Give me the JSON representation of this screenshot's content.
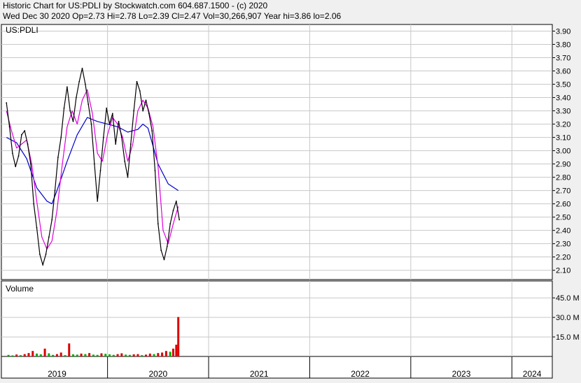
{
  "header": {
    "line1": "Historic Chart for US:PDLI by Stockwatch.com 604.687.1500 - (c) 2020",
    "line2": "Wed Dec 30 2020   Op=2.73  Hi=2.78  Lo=2.39  Cl=2.47  Vol=30,266,907  Year hi=3.86  lo=2.06"
  },
  "chart_data": {
    "type": "line",
    "symbol_label": "US:PDLI",
    "volume_label": "Volume",
    "price_axis": {
      "ticks": [
        "3.90",
        "3.80",
        "3.70",
        "3.60",
        "3.50",
        "3.40",
        "3.30",
        "3.20",
        "3.10",
        "3.00",
        "2.90",
        "2.80",
        "2.70",
        "2.60",
        "2.50",
        "2.40",
        "2.30",
        "2.20",
        "2.10"
      ],
      "range": [
        2.03,
        3.95
      ]
    },
    "volume_axis": {
      "ticks": [
        "45.0 M",
        "30.0 M",
        "15.0 M"
      ],
      "tick_values": [
        45,
        30,
        15
      ],
      "range": [
        0,
        58
      ]
    },
    "years": [
      "2019",
      "2020",
      "2021",
      "2022",
      "2023",
      "2024"
    ],
    "x_range": [
      2018.95,
      2024.4
    ],
    "grid": true,
    "colors": {
      "price": "#000000",
      "ma_short": "#e000e0",
      "ma_long": "#0000cc",
      "vol_up": "#00aa00",
      "vol_down": "#dd0000"
    },
    "price_series": [
      [
        2019.0,
        3.36
      ],
      [
        2019.03,
        3.18
      ],
      [
        2019.06,
        2.98
      ],
      [
        2019.09,
        2.88
      ],
      [
        2019.12,
        2.96
      ],
      [
        2019.15,
        3.12
      ],
      [
        2019.18,
        3.15
      ],
      [
        2019.21,
        3.05
      ],
      [
        2019.24,
        2.9
      ],
      [
        2019.27,
        2.6
      ],
      [
        2019.3,
        2.42
      ],
      [
        2019.33,
        2.22
      ],
      [
        2019.36,
        2.14
      ],
      [
        2019.39,
        2.22
      ],
      [
        2019.42,
        2.35
      ],
      [
        2019.45,
        2.48
      ],
      [
        2019.48,
        2.7
      ],
      [
        2019.51,
        2.95
      ],
      [
        2019.54,
        3.1
      ],
      [
        2019.57,
        3.32
      ],
      [
        2019.6,
        3.48
      ],
      [
        2019.63,
        3.3
      ],
      [
        2019.66,
        3.22
      ],
      [
        2019.69,
        3.4
      ],
      [
        2019.72,
        3.52
      ],
      [
        2019.75,
        3.62
      ],
      [
        2019.78,
        3.5
      ],
      [
        2019.81,
        3.35
      ],
      [
        2019.84,
        3.2
      ],
      [
        2019.87,
        2.9
      ],
      [
        2019.9,
        2.62
      ],
      [
        2019.93,
        2.85
      ],
      [
        2019.96,
        3.1
      ],
      [
        2019.99,
        3.32
      ],
      [
        2020.02,
        3.2
      ],
      [
        2020.05,
        3.28
      ],
      [
        2020.08,
        3.05
      ],
      [
        2020.11,
        3.22
      ],
      [
        2020.14,
        3.1
      ],
      [
        2020.17,
        2.92
      ],
      [
        2020.2,
        2.8
      ],
      [
        2020.23,
        3.05
      ],
      [
        2020.26,
        3.3
      ],
      [
        2020.29,
        3.52
      ],
      [
        2020.32,
        3.45
      ],
      [
        2020.35,
        3.3
      ],
      [
        2020.38,
        3.38
      ],
      [
        2020.41,
        3.28
      ],
      [
        2020.44,
        3.15
      ],
      [
        2020.47,
        2.85
      ],
      [
        2020.5,
        2.45
      ],
      [
        2020.53,
        2.25
      ],
      [
        2020.56,
        2.18
      ],
      [
        2020.59,
        2.28
      ],
      [
        2020.62,
        2.45
      ],
      [
        2020.65,
        2.55
      ],
      [
        2020.68,
        2.62
      ],
      [
        2020.71,
        2.48
      ]
    ],
    "ma_short": [
      [
        2019.0,
        3.3
      ],
      [
        2019.05,
        3.15
      ],
      [
        2019.1,
        3.02
      ],
      [
        2019.15,
        3.05
      ],
      [
        2019.2,
        3.08
      ],
      [
        2019.25,
        2.9
      ],
      [
        2019.3,
        2.62
      ],
      [
        2019.35,
        2.35
      ],
      [
        2019.4,
        2.26
      ],
      [
        2019.45,
        2.32
      ],
      [
        2019.5,
        2.55
      ],
      [
        2019.55,
        2.88
      ],
      [
        2019.6,
        3.18
      ],
      [
        2019.65,
        3.3
      ],
      [
        2019.7,
        3.2
      ],
      [
        2019.75,
        3.38
      ],
      [
        2019.8,
        3.46
      ],
      [
        2019.85,
        3.28
      ],
      [
        2019.9,
        2.98
      ],
      [
        2019.95,
        2.92
      ],
      [
        2020.0,
        3.12
      ],
      [
        2020.05,
        3.25
      ],
      [
        2020.1,
        3.2
      ],
      [
        2020.15,
        3.1
      ],
      [
        2020.2,
        2.92
      ],
      [
        2020.25,
        3.05
      ],
      [
        2020.3,
        3.3
      ],
      [
        2020.35,
        3.38
      ],
      [
        2020.4,
        3.32
      ],
      [
        2020.45,
        3.18
      ],
      [
        2020.5,
        2.88
      ],
      [
        2020.55,
        2.4
      ],
      [
        2020.6,
        2.3
      ],
      [
        2020.65,
        2.45
      ],
      [
        2020.7,
        2.58
      ]
    ],
    "ma_long": [
      [
        2019.0,
        3.1
      ],
      [
        2019.1,
        3.06
      ],
      [
        2019.2,
        2.94
      ],
      [
        2019.3,
        2.72
      ],
      [
        2019.4,
        2.62
      ],
      [
        2019.45,
        2.6
      ],
      [
        2019.5,
        2.7
      ],
      [
        2019.6,
        2.92
      ],
      [
        2019.7,
        3.12
      ],
      [
        2019.8,
        3.25
      ],
      [
        2019.9,
        3.22
      ],
      [
        2020.0,
        3.2
      ],
      [
        2020.1,
        3.18
      ],
      [
        2020.2,
        3.14
      ],
      [
        2020.3,
        3.16
      ],
      [
        2020.35,
        3.2
      ],
      [
        2020.4,
        3.17
      ],
      [
        2020.5,
        2.9
      ],
      [
        2020.6,
        2.75
      ],
      [
        2020.7,
        2.7
      ]
    ],
    "volume_bars": [
      [
        2019.02,
        1.2
      ],
      [
        2019.06,
        0.8
      ],
      [
        2019.1,
        1.5
      ],
      [
        2019.14,
        1.0
      ],
      [
        2019.18,
        1.8
      ],
      [
        2019.22,
        2.6
      ],
      [
        2019.26,
        4.2
      ],
      [
        2019.3,
        2.2
      ],
      [
        2019.34,
        1.6
      ],
      [
        2019.38,
        6.0
      ],
      [
        2019.42,
        2.4
      ],
      [
        2019.46,
        1.2
      ],
      [
        2019.5,
        1.8
      ],
      [
        2019.54,
        3.0
      ],
      [
        2019.58,
        1.0
      ],
      [
        2019.62,
        10.0
      ],
      [
        2019.66,
        1.6
      ],
      [
        2019.7,
        1.4
      ],
      [
        2019.74,
        2.2
      ],
      [
        2019.78,
        1.8
      ],
      [
        2019.82,
        2.6
      ],
      [
        2019.86,
        1.4
      ],
      [
        2019.9,
        1.2
      ],
      [
        2019.94,
        2.4
      ],
      [
        2019.98,
        2.0
      ],
      [
        2020.02,
        1.6
      ],
      [
        2020.06,
        1.2
      ],
      [
        2020.1,
        1.8
      ],
      [
        2020.14,
        2.4
      ],
      [
        2020.18,
        1.4
      ],
      [
        2020.22,
        1.2
      ],
      [
        2020.26,
        1.6
      ],
      [
        2020.3,
        1.8
      ],
      [
        2020.34,
        1.0
      ],
      [
        2020.38,
        1.4
      ],
      [
        2020.42,
        2.2
      ],
      [
        2020.46,
        1.8
      ],
      [
        2020.5,
        2.6
      ],
      [
        2020.54,
        3.0
      ],
      [
        2020.58,
        4.2
      ],
      [
        2020.62,
        3.6
      ],
      [
        2020.65,
        6.0
      ],
      [
        2020.68,
        9.0
      ],
      [
        2020.7,
        30.3
      ]
    ]
  }
}
